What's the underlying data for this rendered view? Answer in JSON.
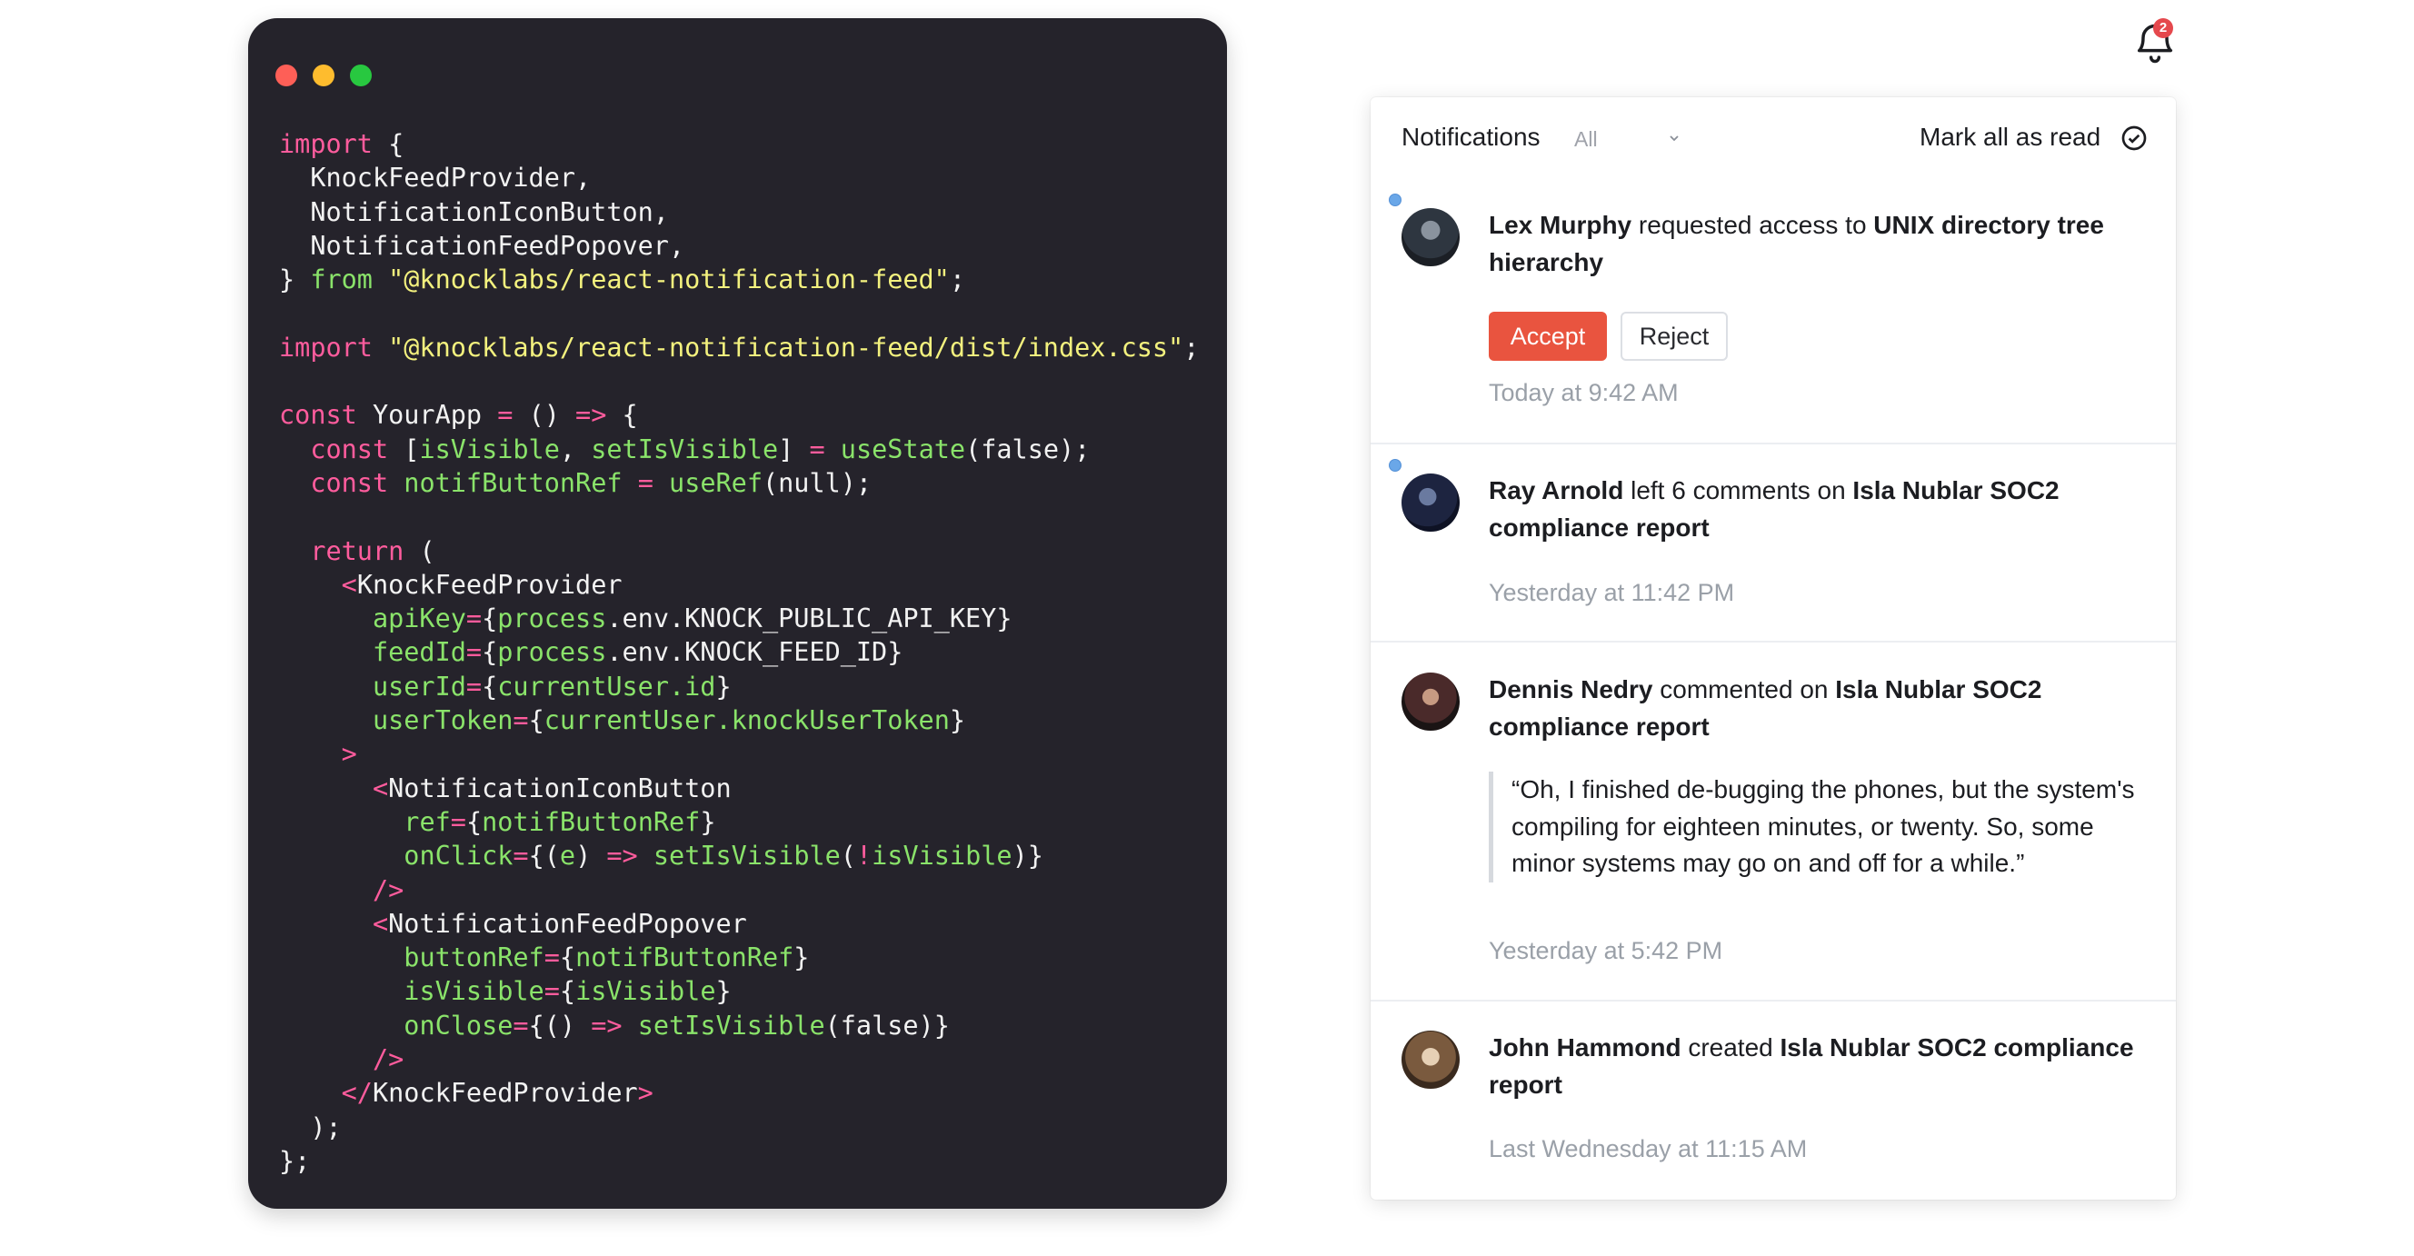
{
  "code": {
    "lines": [
      [
        {
          "c": "k",
          "t": "import"
        },
        {
          "c": "w",
          "t": " {"
        }
      ],
      [
        {
          "c": "w",
          "t": "  KnockFeedProvider,"
        }
      ],
      [
        {
          "c": "w",
          "t": "  NotificationIconButton,"
        }
      ],
      [
        {
          "c": "w",
          "t": "  NotificationFeedPopover,"
        }
      ],
      [
        {
          "c": "w",
          "t": "} "
        },
        {
          "c": "g",
          "t": "from"
        },
        {
          "c": "w",
          "t": " "
        },
        {
          "c": "s",
          "t": "\"@knocklabs/react-notification-feed\""
        },
        {
          "c": "w",
          "t": ";"
        }
      ],
      [],
      [
        {
          "c": "k",
          "t": "import"
        },
        {
          "c": "w",
          "t": " "
        },
        {
          "c": "s",
          "t": "\"@knocklabs/react-notification-feed/dist/index.css\""
        },
        {
          "c": "w",
          "t": ";"
        }
      ],
      [],
      [
        {
          "c": "k",
          "t": "const"
        },
        {
          "c": "w",
          "t": " YourApp "
        },
        {
          "c": "k",
          "t": "="
        },
        {
          "c": "w",
          "t": " () "
        },
        {
          "c": "k",
          "t": "=>"
        },
        {
          "c": "w",
          "t": " {"
        }
      ],
      [
        {
          "c": "w",
          "t": "  "
        },
        {
          "c": "k",
          "t": "const"
        },
        {
          "c": "w",
          "t": " ["
        },
        {
          "c": "g",
          "t": "isVisible"
        },
        {
          "c": "w",
          "t": ", "
        },
        {
          "c": "g",
          "t": "setIsVisible"
        },
        {
          "c": "w",
          "t": "] "
        },
        {
          "c": "k",
          "t": "="
        },
        {
          "c": "w",
          "t": " "
        },
        {
          "c": "g",
          "t": "useState"
        },
        {
          "c": "w",
          "t": "(false);"
        }
      ],
      [
        {
          "c": "w",
          "t": "  "
        },
        {
          "c": "k",
          "t": "const"
        },
        {
          "c": "w",
          "t": " "
        },
        {
          "c": "g",
          "t": "notifButtonRef"
        },
        {
          "c": "w",
          "t": " "
        },
        {
          "c": "k",
          "t": "="
        },
        {
          "c": "w",
          "t": " "
        },
        {
          "c": "g",
          "t": "useRef"
        },
        {
          "c": "w",
          "t": "(null);"
        }
      ],
      [],
      [
        {
          "c": "w",
          "t": "  "
        },
        {
          "c": "k",
          "t": "return"
        },
        {
          "c": "w",
          "t": " ("
        }
      ],
      [
        {
          "c": "w",
          "t": "    "
        },
        {
          "c": "k",
          "t": "<"
        },
        {
          "c": "w",
          "t": "KnockFeedProvider"
        }
      ],
      [
        {
          "c": "w",
          "t": "      "
        },
        {
          "c": "g",
          "t": "apiKey"
        },
        {
          "c": "k",
          "t": "="
        },
        {
          "c": "w",
          "t": "{"
        },
        {
          "c": "g",
          "t": "process"
        },
        {
          "c": "w",
          "t": ".env.KNOCK_PUBLIC_API_KEY}"
        }
      ],
      [
        {
          "c": "w",
          "t": "      "
        },
        {
          "c": "g",
          "t": "feedId"
        },
        {
          "c": "k",
          "t": "="
        },
        {
          "c": "w",
          "t": "{"
        },
        {
          "c": "g",
          "t": "process"
        },
        {
          "c": "w",
          "t": ".env.KNOCK_FEED_ID}"
        }
      ],
      [
        {
          "c": "w",
          "t": "      "
        },
        {
          "c": "g",
          "t": "userId"
        },
        {
          "c": "k",
          "t": "="
        },
        {
          "c": "w",
          "t": "{"
        },
        {
          "c": "g",
          "t": "currentUser.id"
        },
        {
          "c": "w",
          "t": "}"
        }
      ],
      [
        {
          "c": "w",
          "t": "      "
        },
        {
          "c": "g",
          "t": "userToken"
        },
        {
          "c": "k",
          "t": "="
        },
        {
          "c": "w",
          "t": "{"
        },
        {
          "c": "g",
          "t": "currentUser.knockUserToken"
        },
        {
          "c": "w",
          "t": "}"
        }
      ],
      [
        {
          "c": "w",
          "t": "    "
        },
        {
          "c": "k",
          "t": ">"
        }
      ],
      [
        {
          "c": "w",
          "t": "      "
        },
        {
          "c": "k",
          "t": "<"
        },
        {
          "c": "w",
          "t": "NotificationIconButton"
        }
      ],
      [
        {
          "c": "w",
          "t": "        "
        },
        {
          "c": "g",
          "t": "ref"
        },
        {
          "c": "k",
          "t": "="
        },
        {
          "c": "w",
          "t": "{"
        },
        {
          "c": "g",
          "t": "notifButtonRef"
        },
        {
          "c": "w",
          "t": "}"
        }
      ],
      [
        {
          "c": "w",
          "t": "        "
        },
        {
          "c": "g",
          "t": "onClick"
        },
        {
          "c": "k",
          "t": "="
        },
        {
          "c": "w",
          "t": "{("
        },
        {
          "c": "g",
          "t": "e"
        },
        {
          "c": "w",
          "t": ") "
        },
        {
          "c": "k",
          "t": "=>"
        },
        {
          "c": "w",
          "t": " "
        },
        {
          "c": "g",
          "t": "setIsVisible"
        },
        {
          "c": "w",
          "t": "("
        },
        {
          "c": "k",
          "t": "!"
        },
        {
          "c": "g",
          "t": "isVisible"
        },
        {
          "c": "w",
          "t": ")}"
        }
      ],
      [
        {
          "c": "w",
          "t": "      "
        },
        {
          "c": "k",
          "t": "/>"
        }
      ],
      [
        {
          "c": "w",
          "t": "      "
        },
        {
          "c": "k",
          "t": "<"
        },
        {
          "c": "w",
          "t": "NotificationFeedPopover"
        }
      ],
      [
        {
          "c": "w",
          "t": "        "
        },
        {
          "c": "g",
          "t": "buttonRef"
        },
        {
          "c": "k",
          "t": "="
        },
        {
          "c": "w",
          "t": "{"
        },
        {
          "c": "g",
          "t": "notifButtonRef"
        },
        {
          "c": "w",
          "t": "}"
        }
      ],
      [
        {
          "c": "w",
          "t": "        "
        },
        {
          "c": "g",
          "t": "isVisible"
        },
        {
          "c": "k",
          "t": "="
        },
        {
          "c": "w",
          "t": "{"
        },
        {
          "c": "g",
          "t": "isVisible"
        },
        {
          "c": "w",
          "t": "}"
        }
      ],
      [
        {
          "c": "w",
          "t": "        "
        },
        {
          "c": "g",
          "t": "onClose"
        },
        {
          "c": "k",
          "t": "="
        },
        {
          "c": "w",
          "t": "{() "
        },
        {
          "c": "k",
          "t": "=>"
        },
        {
          "c": "w",
          "t": " "
        },
        {
          "c": "g",
          "t": "setIsVisible"
        },
        {
          "c": "w",
          "t": "(false)}"
        }
      ],
      [
        {
          "c": "w",
          "t": "      "
        },
        {
          "c": "k",
          "t": "/>"
        }
      ],
      [
        {
          "c": "w",
          "t": "    "
        },
        {
          "c": "k",
          "t": "</"
        },
        {
          "c": "w",
          "t": "KnockFeedProvider"
        },
        {
          "c": "k",
          "t": ">"
        }
      ],
      [
        {
          "c": "w",
          "t": "  );"
        }
      ],
      [
        {
          "c": "w",
          "t": "};"
        }
      ]
    ]
  },
  "bell": {
    "badge_count": "2"
  },
  "feed": {
    "title": "Notifications",
    "filter_label": "All",
    "mark_all_label": "Mark all as read",
    "accept_label": "Accept",
    "reject_label": "Reject",
    "items": [
      {
        "actor": "Lex Murphy",
        "verb": " requested access to ",
        "object": "UNIX directory tree hierarchy",
        "time": "Today at 9:42 AM",
        "unread": true
      },
      {
        "actor": "Ray Arnold",
        "verb": " left 6 comments on ",
        "object": "Isla Nublar SOC2 compliance report",
        "time": "Yesterday at 11:42 PM",
        "unread": true
      },
      {
        "actor": "Dennis Nedry",
        "verb": " commented on ",
        "object": "Isla Nublar SOC2 compliance report",
        "quote": "“Oh, I finished de-bugging the phones, but the system's compiling for eighteen minutes, or twenty. So, some minor systems may go on and off for a while.”",
        "time": "Yesterday at 5:42 PM",
        "unread": false
      },
      {
        "actor": "John Hammond",
        "verb": " created ",
        "object": "Isla Nublar SOC2 compliance report",
        "time": "Last Wednesday at 11:15 AM",
        "unread": false
      }
    ]
  },
  "colors": {
    "code_bg": "#25232b",
    "keyword": "#ff5c9d",
    "string": "#f3f17e",
    "identifier": "#8ae36a",
    "accept_button": "#e9543f",
    "unread_dot": "#6aa7e8",
    "badge": "#e5484d"
  },
  "icons": [
    "bell-icon",
    "chevron-down-icon",
    "check-circle-icon"
  ]
}
